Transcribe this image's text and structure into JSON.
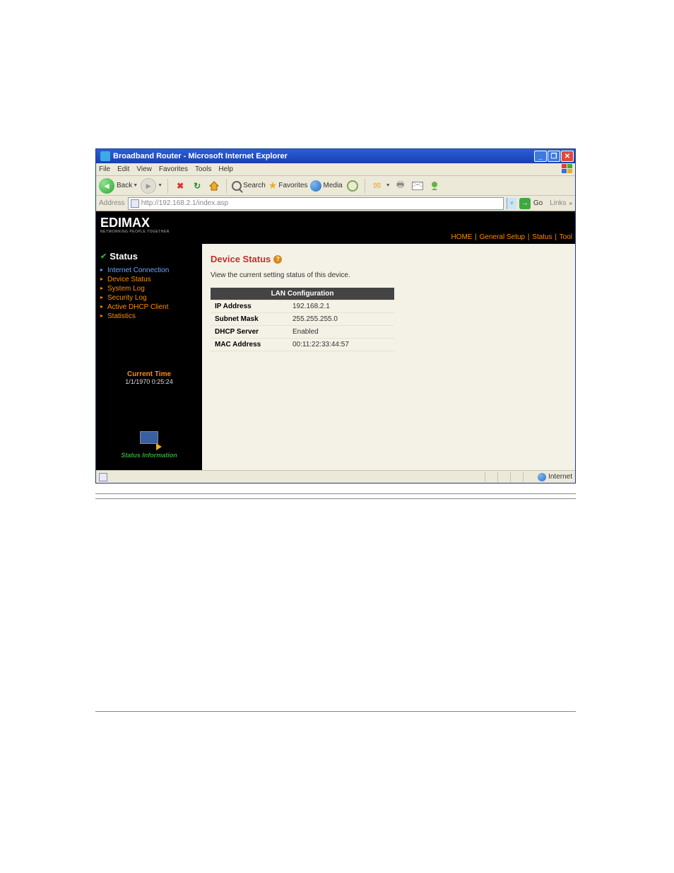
{
  "window": {
    "title": "Broadband Router - Microsoft Internet Explorer"
  },
  "menubar": {
    "file": "File",
    "edit": "Edit",
    "view": "View",
    "favorites": "Favorites",
    "tools": "Tools",
    "help": "Help"
  },
  "toolbar": {
    "back": "Back",
    "search": "Search",
    "favorites": "Favorites",
    "media": "Media"
  },
  "addressbar": {
    "label": "Address",
    "url": "http://192.168.2.1/index.asp",
    "go": "Go",
    "links": "Links"
  },
  "brand": {
    "logo": "EDIMAX",
    "tagline": "NETWORKING PEOPLE TOGETHER"
  },
  "topnav": {
    "home": "HOME",
    "general_setup": "General Setup",
    "status": "Status",
    "tool": "Tool"
  },
  "sidebar": {
    "title": "Status",
    "items": [
      {
        "label": "Internet Connection"
      },
      {
        "label": "Device Status"
      },
      {
        "label": "System Log"
      },
      {
        "label": "Security Log"
      },
      {
        "label": "Active DHCP Client"
      },
      {
        "label": "Statistics"
      }
    ],
    "current_time_label": "Current Time",
    "current_time_value": "1/1/1970 0:25:24",
    "bottom_label": "Status Information"
  },
  "main": {
    "title": "Device Status",
    "description": "View the current setting status of this device.",
    "table_header": "LAN Configuration",
    "rows": [
      {
        "k": "IP Address",
        "v": "192.168.2.1"
      },
      {
        "k": "Subnet Mask",
        "v": "255.255.255.0"
      },
      {
        "k": "DHCP Server",
        "v": "Enabled"
      },
      {
        "k": "MAC Address",
        "v": "00:11:22:33:44:57"
      }
    ]
  },
  "statusbar": {
    "zone": "Internet"
  }
}
